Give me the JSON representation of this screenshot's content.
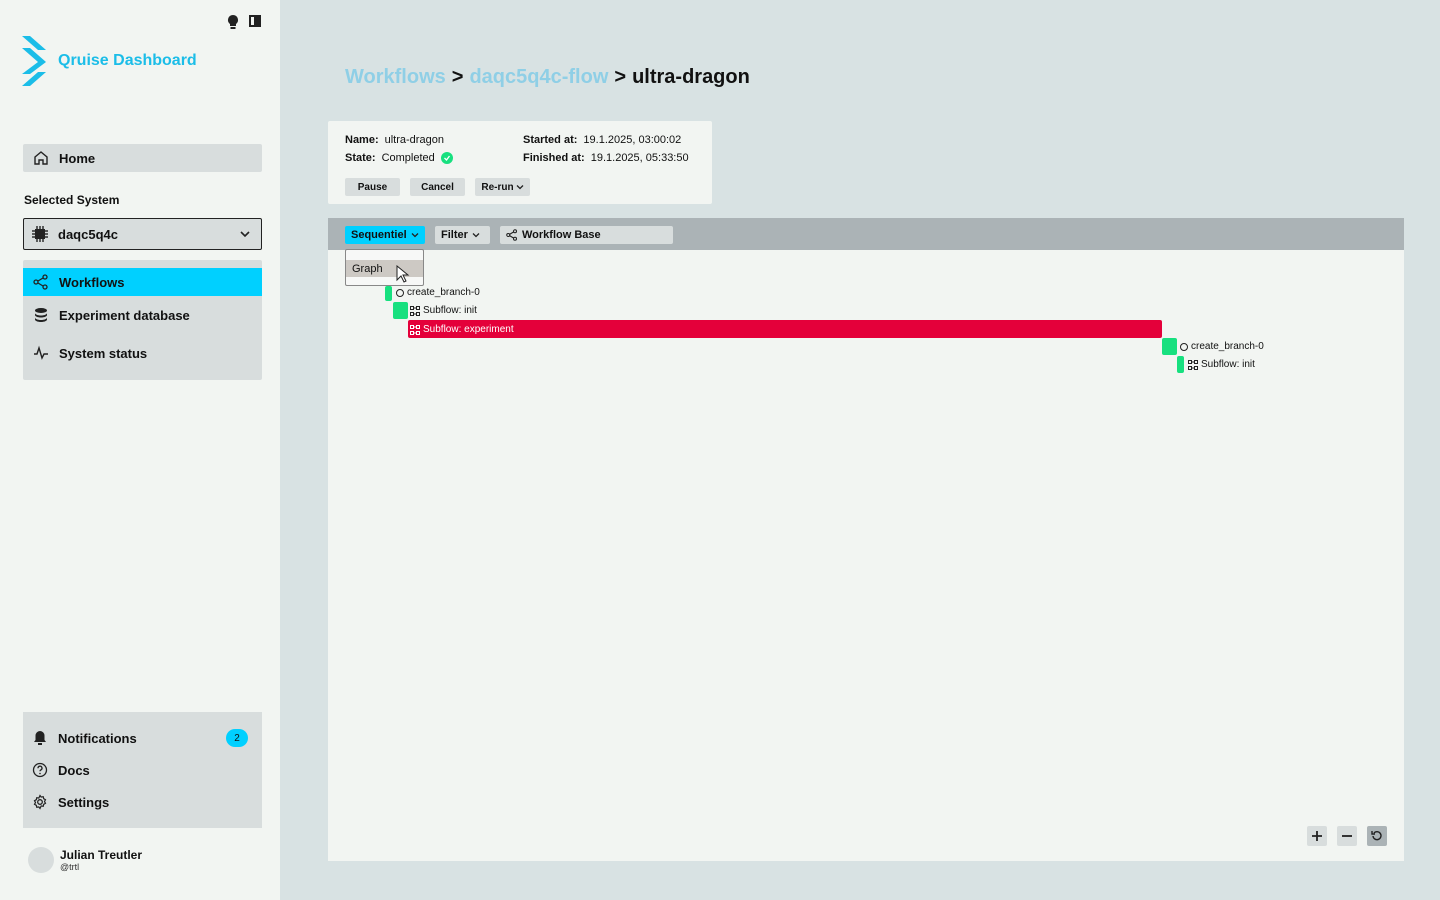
{
  "app": {
    "title": "Qruise Dashboard",
    "accent": "#00d0ff"
  },
  "sidebar": {
    "home_label": "Home",
    "selected_system_label": "Selected System",
    "system_value": "daqc5q4c",
    "nav": [
      "Workflows",
      "Experiment database",
      "System status"
    ],
    "bottom": {
      "notifications_label": "Notifications",
      "notifications_count": "2",
      "docs_label": "Docs",
      "settings_label": "Settings"
    },
    "user": {
      "name": "Julian Treutler",
      "handle": "@trtl"
    }
  },
  "breadcrumb": {
    "workflows": "Workflows",
    "flow": "daqc5q4c-flow",
    "sep": ">",
    "current": "ultra-dragon"
  },
  "info": {
    "name_label": "Name:",
    "name_value": "ultra-dragon",
    "state_label": "State:",
    "state_value": "Completed",
    "started_label": "Started at:",
    "started_value": "19.1.2025, 03:00:02",
    "finished_label": "Finished at:",
    "finished_value": "19.1.2025, 05:33:50",
    "buttons": {
      "pause": "Pause",
      "cancel": "Cancel",
      "rerun": "Re-run"
    }
  },
  "toolbar": {
    "view_mode": "Sequentiel",
    "filter": "Filter",
    "base": "Workflow Base",
    "dropdown_option": "Graph"
  },
  "timeline": {
    "tasks": [
      {
        "label": "create_branch-0",
        "icon": "ring-icon",
        "color": "#17e07f"
      },
      {
        "label": "Subflow: init",
        "icon": "subflow-icon",
        "color": "#17e07f"
      },
      {
        "label": "Subflow: experiment",
        "icon": "subflow-icon",
        "color": "#e4003a"
      },
      {
        "label": "create_branch-0",
        "icon": "ring-icon",
        "color": "#17e07f"
      },
      {
        "label": "Subflow: init",
        "icon": "subflow-icon",
        "color": "#17e07f"
      }
    ]
  }
}
